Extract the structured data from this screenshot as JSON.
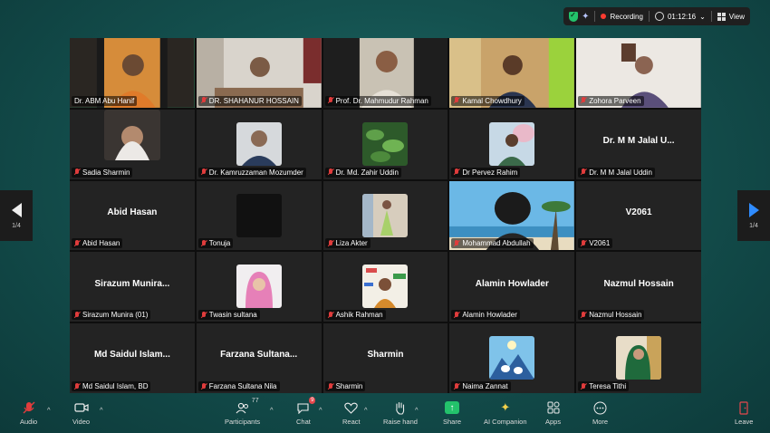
{
  "status": {
    "recording_label": "Recording",
    "timer": "01:12:16",
    "view_label": "View"
  },
  "nav": {
    "left_page": "1/4",
    "right_page": "1/4"
  },
  "participants": [
    {
      "name": "Dr. ABM Abu Hanif",
      "active": true,
      "muted": false
    },
    {
      "name": "DR. SHAHANUR HOSSAIN",
      "muted": true
    },
    {
      "name": "Prof. Dr. Mahmudur Rahman",
      "muted": true
    },
    {
      "name": "Kamal Chowdhury",
      "muted": true
    },
    {
      "name": "Zohora Parveen",
      "muted": true
    },
    {
      "name": "Sadia Sharmin",
      "muted": true
    },
    {
      "name": "Dr. Kamruzzaman Mozumder",
      "muted": true
    },
    {
      "name": "Dr. Md. Zahir Uddin",
      "muted": true
    },
    {
      "name": "Dr Pervez Rahim",
      "muted": true
    },
    {
      "name": "Dr. M M Jalal Uddin",
      "display": "Dr. M M Jalal U...",
      "muted": true
    },
    {
      "name": "Abid Hasan",
      "display": "Abid Hasan",
      "muted": true
    },
    {
      "name": "Tonuja",
      "muted": true
    },
    {
      "name": "Liza Akter",
      "muted": true
    },
    {
      "name": "Mohammad Abdullah",
      "muted": true
    },
    {
      "name": "V2061",
      "display": "V2061",
      "muted": true
    },
    {
      "name": "Sirazum Munira (01)",
      "display": "Sirazum  Munira...",
      "muted": true
    },
    {
      "name": "Twasin sultana",
      "muted": true
    },
    {
      "name": "Ashik Rahman",
      "muted": true
    },
    {
      "name": "Alamin Howlader",
      "display": "Alamin Howlader",
      "muted": true
    },
    {
      "name": "Nazmul Hossain",
      "display": "Nazmul Hossain",
      "muted": true
    },
    {
      "name": "Md Saidul Islam, BD",
      "display": "Md Saidul Islam...",
      "muted": true
    },
    {
      "name": "Farzana Sultana Nila",
      "display": "Farzana  Sultana...",
      "muted": true
    },
    {
      "name": "Sharmin",
      "display": "Sharmin",
      "muted": true
    },
    {
      "name": "Naima Zannat",
      "muted": true
    },
    {
      "name": "Teresa Tithi",
      "muted": true
    }
  ],
  "toolbar": {
    "audio": "Audio",
    "video": "Video",
    "participants": "Participants",
    "participants_count": "77",
    "chat": "Chat",
    "chat_badge": "9",
    "react": "React",
    "raise_hand": "Raise hand",
    "share": "Share",
    "ai_companion": "AI Companion",
    "apps": "Apps",
    "more": "More",
    "leave": "Leave"
  }
}
